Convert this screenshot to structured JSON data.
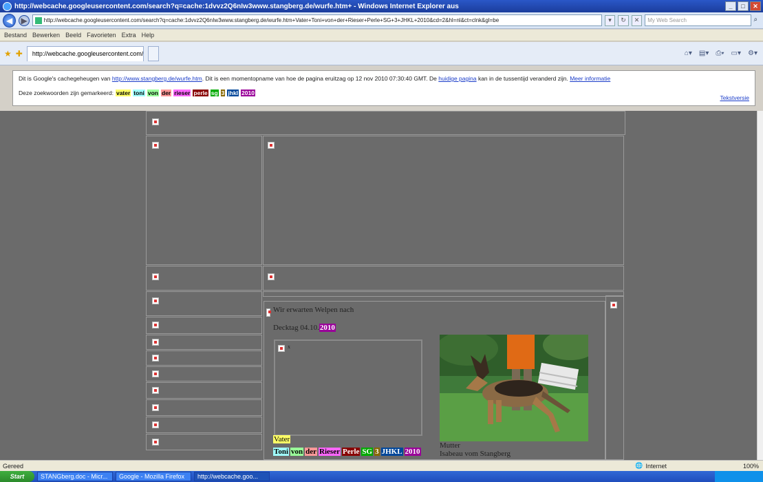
{
  "window": {
    "title": "http://webcache.googleusercontent.com/search?q=cache:1dvvz2Q6nIw3www.stangberg.de/wurfe.htm+ - Windows Internet Explorer aus",
    "buttons": [
      "_",
      "□",
      "✕"
    ]
  },
  "addressbar": {
    "url": "http://webcache.googleusercontent.com/search?q=cache:1dvvz2Q6nIw3www.stangberg.de/wurfe.htm+Vater+Toni+von+der+Rieser+Perle+SG+3+JHKL+2010&cd=2&hl=nl&ct=clnk&gl=be",
    "search_placeholder": "My Web Search"
  },
  "menubar": {
    "items": [
      "Bestand",
      "Bewerken",
      "Beeld",
      "Favorieten",
      "Extra",
      "Help"
    ]
  },
  "tab": {
    "label": "http://webcache.googleusercontent.com/search?q=c..."
  },
  "cache_banner": {
    "intro": "Dit is Google's cachegeheugen van",
    "cached_url": "http://www.stangberg.de/wurfe.htm",
    "snapshot_text": ". Dit is een momentopname van hoe de pagina eruitzag op 12 nov 2010 07:30:40 GMT. De",
    "current_page_link": "huidige pagina",
    "changed_text": "kan in de tussentijd veranderd zijn.",
    "more_info_link": "Meer informatie",
    "keywords_label": "Deze zoekwoorden zijn gemarkeerd:",
    "keywords": [
      "vater",
      "toni",
      "von",
      "der",
      "rieser",
      "perle",
      "sg",
      "3",
      "jhkl",
      "2010"
    ],
    "text_version_link": "Tekstversie"
  },
  "page": {
    "heading": "Wir erwarten Welpen nach",
    "decktag_label": "Decktag 04.10.",
    "decktag_year": "2010",
    "inner_alt": "x",
    "father_label": "Vater",
    "father_words": [
      "Toni",
      "von",
      "der",
      "Rieser",
      "Perle",
      "SG",
      "3",
      "JHKL",
      "2010"
    ],
    "mother_label": "Mutter",
    "mother_name": "Isabeau vom Stangberg"
  },
  "statusbar": {
    "status": "Gereed",
    "zone": "Internet",
    "zoom": "100%"
  },
  "taskbar": {
    "start": "Start",
    "items": [
      "STANGberg.doc - Micr...",
      "Google - Mozilla Firefox",
      "http://webcache.goo..."
    ]
  }
}
